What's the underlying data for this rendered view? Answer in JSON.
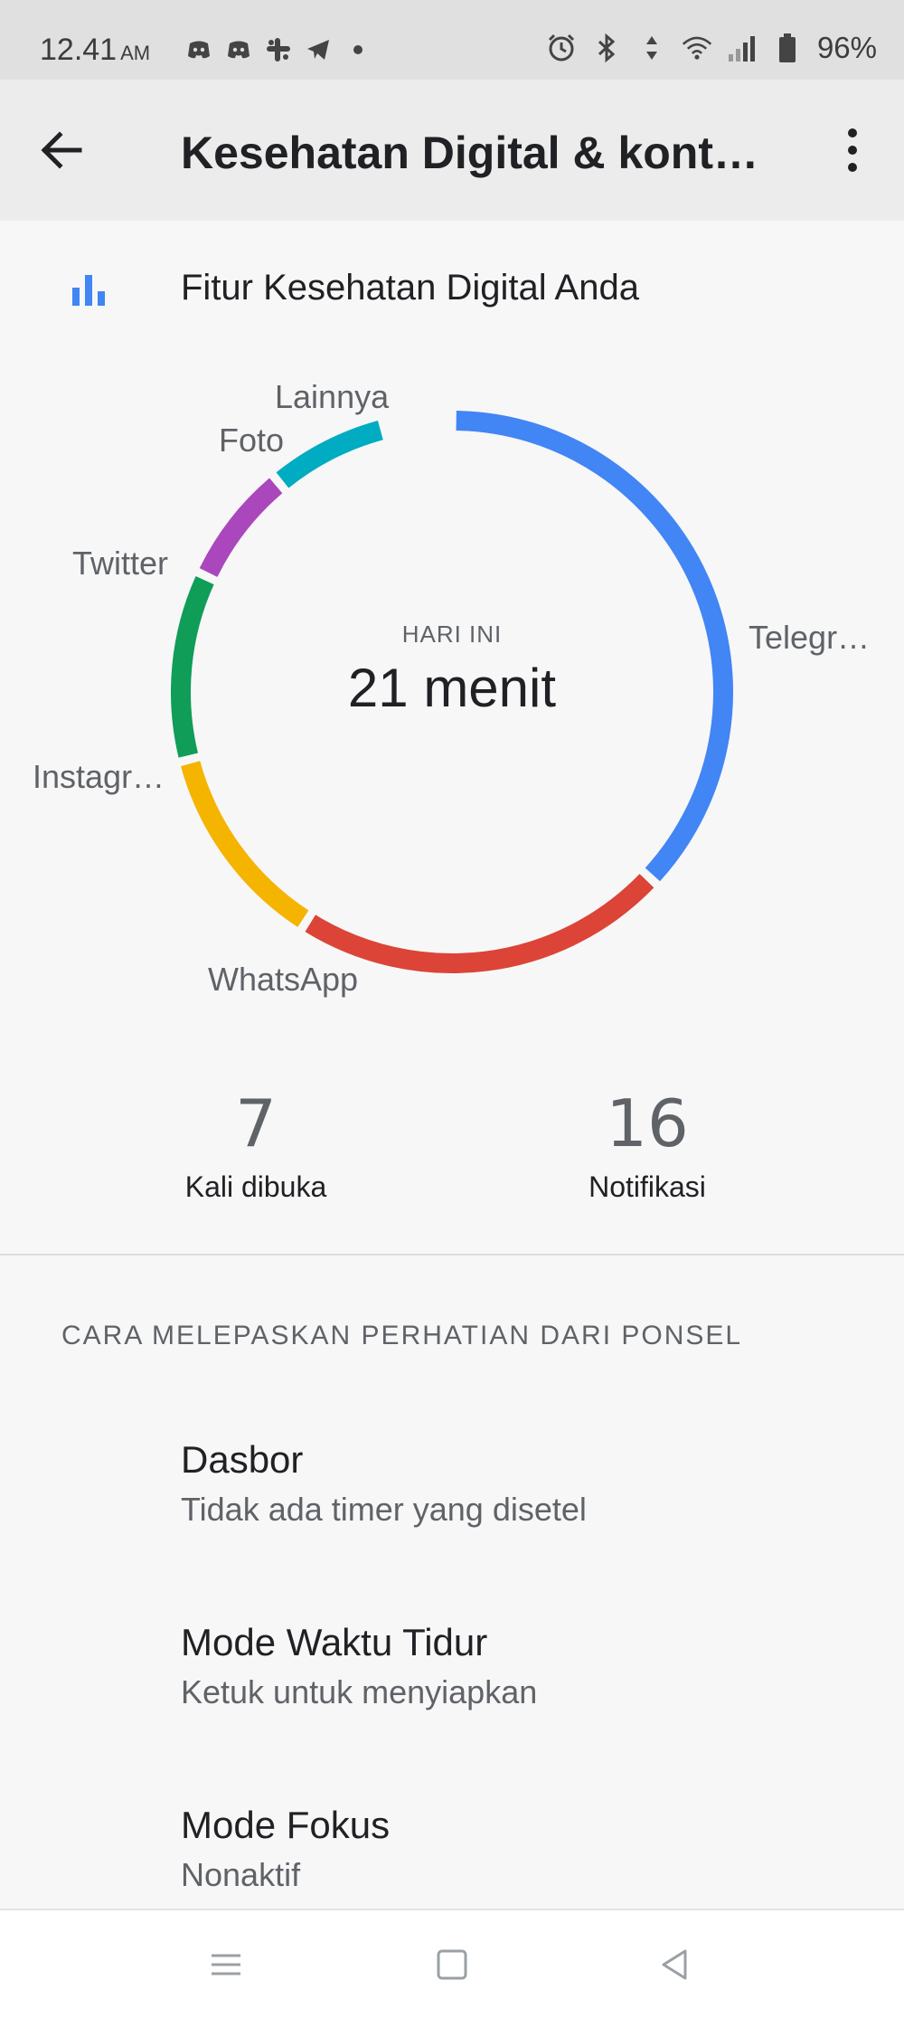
{
  "status_bar": {
    "time": "12.41",
    "ampm": "AM",
    "battery": "96%",
    "notification_icons": [
      "discord-icon",
      "discord-icon",
      "slack-icon",
      "telegram-icon",
      "dot-icon"
    ],
    "system_icons": [
      "alarm-icon",
      "bluetooth-icon",
      "data-icon",
      "wifi-icon",
      "signal-icon",
      "battery-icon"
    ]
  },
  "app_bar": {
    "title": "Kesehatan Digital & kont…",
    "back_icon": "arrow-left-icon",
    "more_icon": "more-vert-icon"
  },
  "feature": {
    "label": "Fitur Kesehatan Digital Anda",
    "icon": "bar-chart-icon"
  },
  "usage": {
    "period_label": "HARI INI",
    "total": "21 menit",
    "segments": [
      {
        "label": "Telegr…",
        "share": 0.37,
        "color": "#4285f4"
      },
      {
        "label": "WhatsApp",
        "share": 0.22,
        "color": "#db4437"
      },
      {
        "label": "Instagr…",
        "share": 0.12,
        "color": "#f4b400"
      },
      {
        "label": "Twitter",
        "share": 0.11,
        "color": "#0f9d58"
      },
      {
        "label": "Foto",
        "share": 0.07,
        "color": "#ab47bc"
      },
      {
        "label": "Lainnya",
        "share": 0.07,
        "color": "#00acc1"
      }
    ]
  },
  "stats": {
    "unlocks_value": "7",
    "unlocks_label": "Kali dibuka",
    "notifications_value": "16",
    "notifications_label": "Notifikasi"
  },
  "section": {
    "header": "CARA MELEPASKAN PERHATIAN DARI PONSEL"
  },
  "items": [
    {
      "title": "Dasbor",
      "subtitle": "Tidak ada timer yang disetel"
    },
    {
      "title": "Mode Waktu Tidur",
      "subtitle": "Ketuk untuk menyiapkan"
    },
    {
      "title": "Mode Fokus",
      "subtitle": "Nonaktif"
    }
  ],
  "nav_bar": {
    "icons": [
      "menu-icon",
      "home-square-icon",
      "back-triangle-icon"
    ]
  }
}
